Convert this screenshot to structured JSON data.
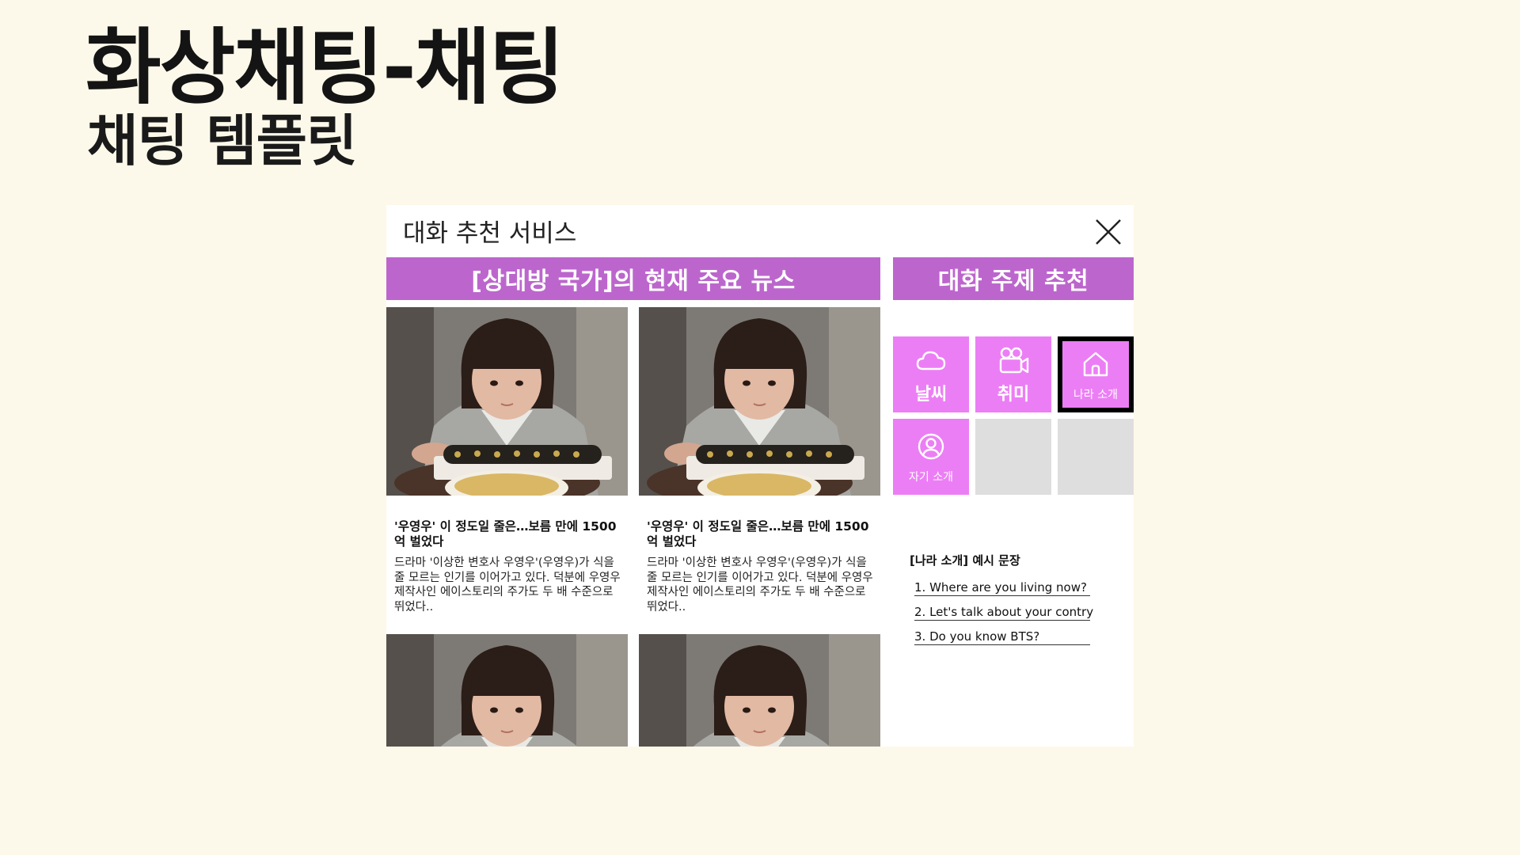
{
  "slide": {
    "title": "화상채팅-채팅",
    "subtitle": "채팅 템플릿"
  },
  "panel": {
    "title": "대화 추천 서비스",
    "close_icon": "close-icon",
    "news_header": "[상대방 국가]의 현재 주요 뉴스",
    "topic_header": "대화 주제 추천"
  },
  "news": [
    {
      "headline": "'우영우' 이 정도일 줄은…보름 만에 1500억 벌었다",
      "body": "드라마 '이상한 변호사 우영우'(우영우)가 식을 줄 모르는 인기를 이어가고 있다. 덕분에 우영우 제작사인 에이스토리의 주가도 두 배 수준으로 뛰었다.."
    },
    {
      "headline": "'우영우' 이 정도일 줄은…보름 만에 1500억 벌었다",
      "body": "드라마 '이상한 변호사 우영우'(우영우)가 식을 줄 모르는 인기를 이어가고 있다. 덕분에 우영우 제작사인 에이스토리의 주가도 두 배 수준으로 뛰었다.."
    },
    {
      "headline": "",
      "body": ""
    },
    {
      "headline": "",
      "body": ""
    }
  ],
  "topics": [
    {
      "label": "날씨",
      "icon": "cloud-icon",
      "selected": false
    },
    {
      "label": "취미",
      "icon": "video-camera-icon",
      "selected": false
    },
    {
      "label": "나라 소개",
      "icon": "home-icon",
      "selected": true
    },
    {
      "label": "자기 소개",
      "icon": "user-circle-icon",
      "selected": false
    }
  ],
  "examples": {
    "title": "[나라 소개] 예시 문장",
    "items": [
      "1.  Where are you living now?",
      "2. Let's talk about your contry",
      "3. Do you know BTS?"
    ]
  },
  "colors": {
    "background": "#fdf9ea",
    "header_purple": "#bc66cd",
    "tile_pink": "#ec7ef5",
    "tile_empty": "#dedede"
  }
}
